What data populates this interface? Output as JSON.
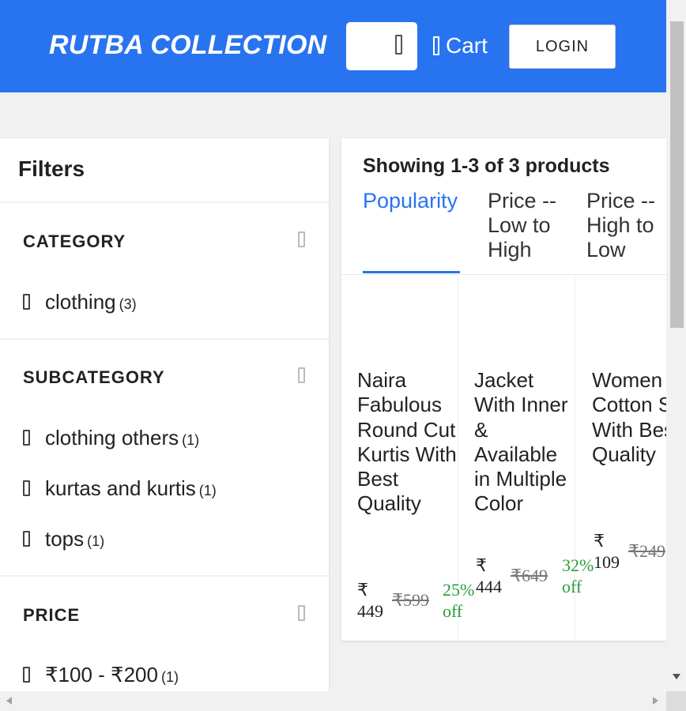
{
  "header": {
    "brand": "RUTBA COLLECTION",
    "cart_label": "Cart",
    "login_label": "LOGIN"
  },
  "filters": {
    "title": "Filters",
    "sections": [
      {
        "title": "CATEGORY",
        "options": [
          {
            "label": "clothing",
            "count": "(3)"
          }
        ]
      },
      {
        "title": "SUBCATEGORY",
        "options": [
          {
            "label": "clothing others",
            "count": "(1)"
          },
          {
            "label": "kurtas and kurtis",
            "count": "(1)"
          },
          {
            "label": "tops",
            "count": "(1)"
          }
        ]
      },
      {
        "title": "PRICE",
        "options": [
          {
            "label": "₹100 - ₹200",
            "count": "(1)"
          }
        ]
      }
    ]
  },
  "listing": {
    "showing_text": "Showing 1-3 of 3 products",
    "sort_options": [
      "Popularity",
      "Price -- Low to High",
      "Price -- High to Low"
    ],
    "active_sort": "Popularity"
  },
  "products": [
    {
      "name": "Naira Fabulous Round Cut Kurtis With Best Quality",
      "price": "₹ 449",
      "mrp": "₹599",
      "discount": "25% off"
    },
    {
      "name": "Jacket With Inner & Available in Multiple Color",
      "price": "₹ 444",
      "mrp": "₹649",
      "discount": "32% off"
    },
    {
      "name": "Women Cotton Slip With Best Quality",
      "price": "₹ 109",
      "mrp": "₹249",
      "discount": ""
    }
  ],
  "colors": {
    "brand_blue": "#2874f0",
    "discount_green": "#2a9d3a"
  }
}
